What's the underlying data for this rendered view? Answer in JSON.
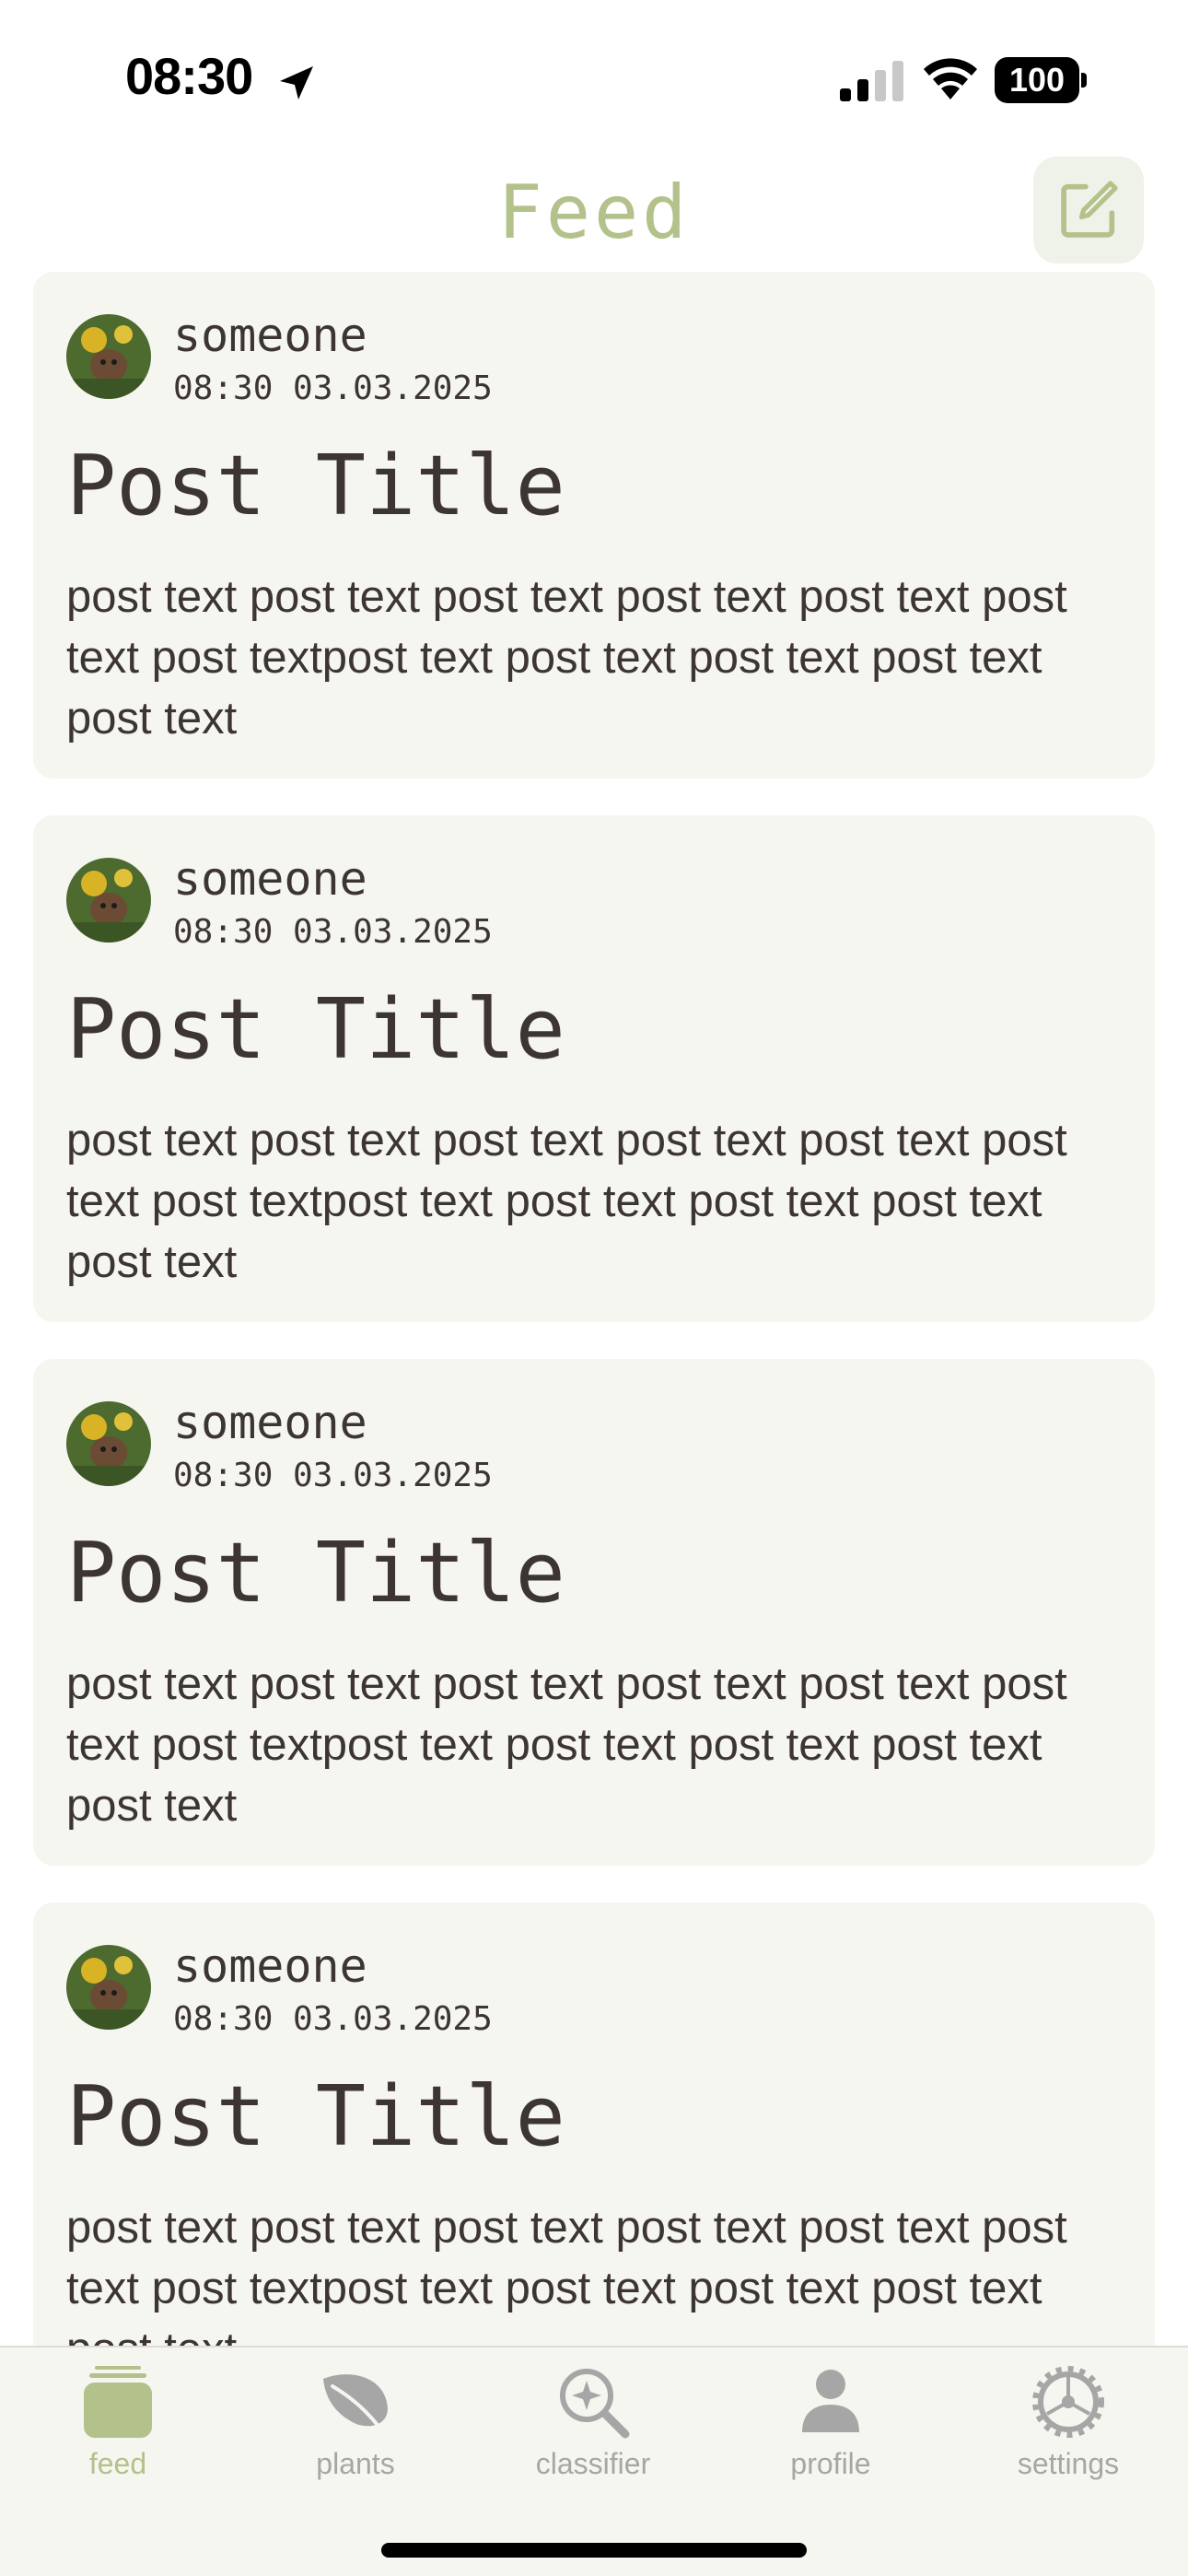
{
  "status_bar": {
    "time": "08:30",
    "battery": "100"
  },
  "header": {
    "title": "Feed"
  },
  "posts": [
    {
      "author": "someone",
      "date": "08:30 03.03.2025",
      "title": "Post Title",
      "body": "post text post text post text post text post text post text post textpost text post text post text post text post text"
    },
    {
      "author": "someone",
      "date": "08:30 03.03.2025",
      "title": "Post Title",
      "body": "post text post text post text post text post text post text post textpost text post text post text post text post text"
    },
    {
      "author": "someone",
      "date": "08:30 03.03.2025",
      "title": "Post Title",
      "body": "post text post text post text post text post text post text post textpost text post text post text post text post text"
    },
    {
      "author": "someone",
      "date": "08:30 03.03.2025",
      "title": "Post Title",
      "body": "post text post text post text post text post text post text post textpost text post text post text post text post text"
    }
  ],
  "tab_bar": {
    "items": [
      {
        "label": "feed",
        "icon": "feed-icon",
        "active": true
      },
      {
        "label": "plants",
        "icon": "leaf-icon",
        "active": false
      },
      {
        "label": "classifier",
        "icon": "sparkle-search-icon",
        "active": false
      },
      {
        "label": "profile",
        "icon": "person-icon",
        "active": false
      },
      {
        "label": "settings",
        "icon": "gear-icon",
        "active": false
      }
    ]
  },
  "colors": {
    "accent": "#b3c18a",
    "card_background": "#f5f6f0",
    "text": "#3d3533",
    "inactive_tab": "#a6a6a6"
  }
}
